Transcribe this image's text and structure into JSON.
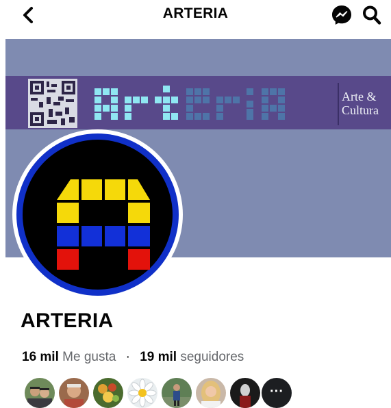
{
  "header": {
    "title": "ARTERIA",
    "icons": [
      "back-arrow-icon",
      "messenger-icon",
      "search-icon"
    ]
  },
  "cover": {
    "wordmark": "arteria",
    "tagline_line1": "Arte &",
    "tagline_line2": "Cultura",
    "colors": {
      "background": "#7f8bb1",
      "banner": "#58498a",
      "wordmark": "#8fe7f2"
    }
  },
  "profile": {
    "name": "ARTERIA",
    "likes_count": "16 mil",
    "likes_label": "Me gusta",
    "followers_count": "19 mil",
    "followers_label": "seguidores",
    "separator": "·",
    "more_label": "···",
    "logo_colors": {
      "yellow": "#f5d90a",
      "blue": "#1230d8",
      "red": "#e3120b",
      "ring": "#1030c8"
    }
  }
}
